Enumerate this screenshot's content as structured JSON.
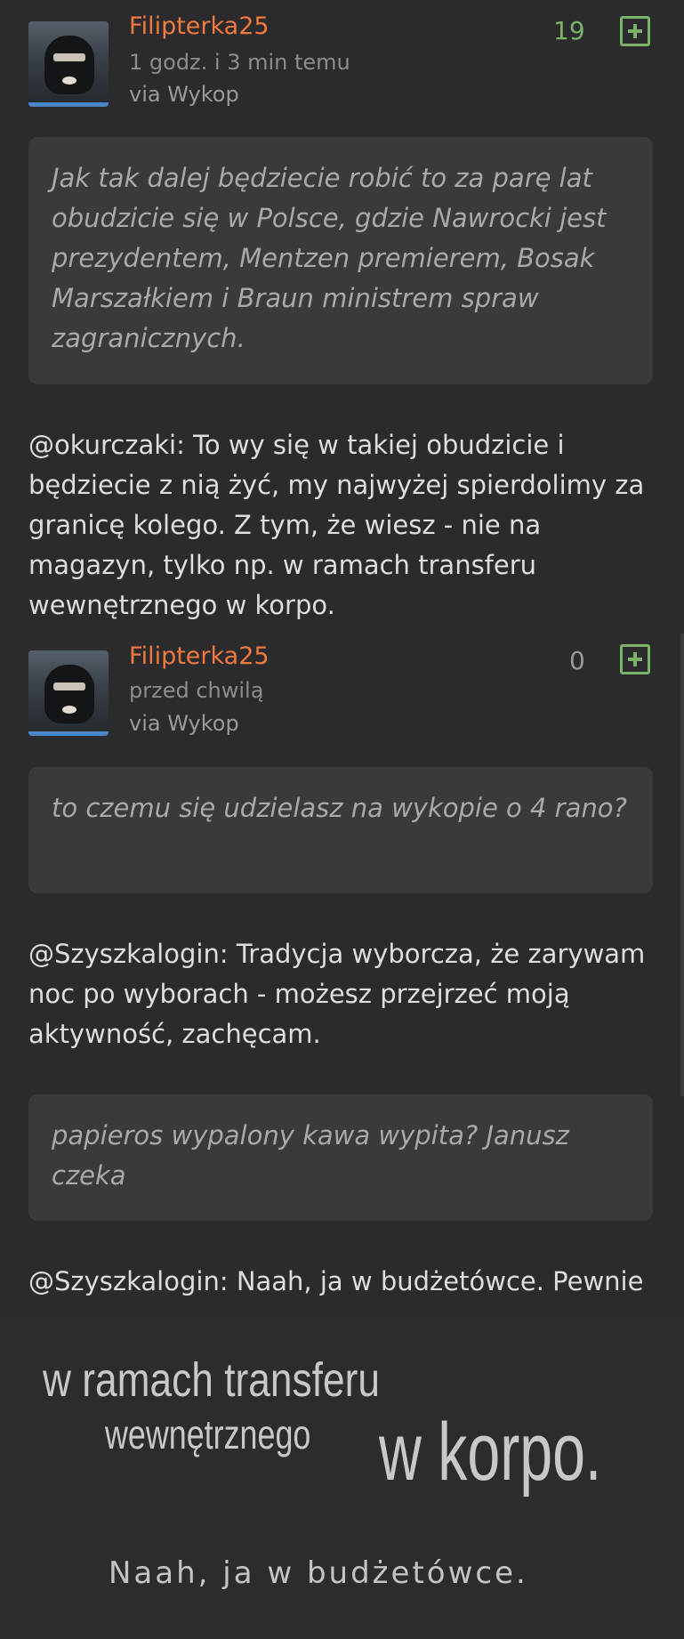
{
  "comments": [
    {
      "username": "Filipterka25",
      "time": "1 godz. i 3 min temu",
      "via": "via Wykop",
      "score": "19",
      "score_color": "#7ab266",
      "quote": "Jak tak dalej będziecie robić to za parę lat obudzicie się w Polsce, gdzie Nawrocki jest prezydentem, Mentzen premierem, Bosak Marszałkiem i Braun ministrem spraw zagranicznych.",
      "reply": "@okurczaki: To wy się w takiej obudzicie i będziecie z nią żyć, my najwyżej spierdolimy za granicę kolego. Z tym, że wiesz - nie na magazyn, tylko np. w ramach transferu wewnętrznego w korpo."
    },
    {
      "username": "Filipterka25",
      "time": "przed chwilą",
      "via": "via Wykop",
      "score": "0",
      "score_color": "#9a9a9a",
      "quote1": "to czemu się udzielasz na wykopie o 4 rano?",
      "reply1": "@Szyszkalogin: Tradycja wyborcza, że zarywam noc po wyborach - możesz przejrzeć moją aktywność, zachęcam.",
      "quote2": "papieros wypalony kawa wypita? Janusz czeka",
      "reply2": "@Szyszkalogin: Naah, ja w budżetówce. Pewnie"
    }
  ],
  "meme": {
    "line1": "w ramach transferu",
    "line2": "wewnętrznego",
    "line3": "w korpo.",
    "line4": "Naah, ja w budżetówce."
  },
  "icons": {
    "plus": "plus-square-icon",
    "avatar": "avatar-image"
  }
}
